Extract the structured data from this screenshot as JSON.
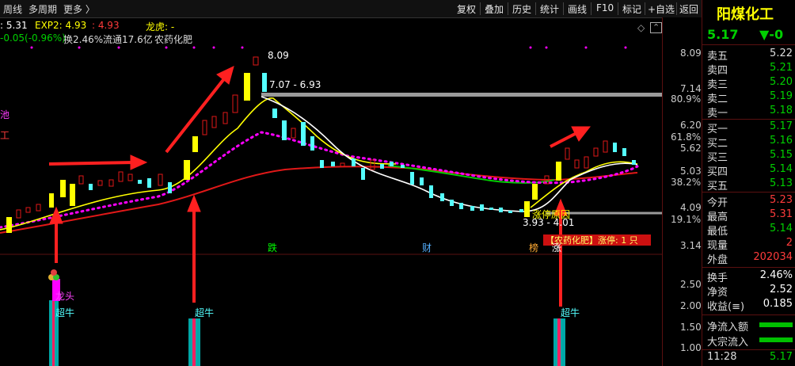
{
  "toolbar": {
    "left": [
      "周线",
      "多周期",
      "更多 〉"
    ],
    "buttons": [
      "复权",
      "叠加",
      "历史",
      "统计",
      "画线",
      "F10",
      "标记",
      "+自选",
      "返回"
    ]
  },
  "info": {
    "ma1": ": 5.31",
    "exp2_label": "EXP2: 4.93",
    "exp3_label": ": 4.93",
    "dragon_label": "龙虎: -",
    "change": "-0.05(-0.96%)",
    "turnover": "换2.46%",
    "float": "流通17.6亿",
    "industry": "农药化肥"
  },
  "side_text": [
    "池",
    "工"
  ],
  "price_axis": {
    "labels": [
      "8.09",
      "7.14",
      "80.9%",
      "6.20",
      "61.8%",
      "5.62",
      "5.03",
      "38.2%",
      "4.09",
      "19.1%",
      "3.14"
    ],
    "lower": [
      "2.50",
      "2.00",
      "1.50",
      "1.00"
    ]
  },
  "chart_annotations": {
    "high": "8.09",
    "range1": "7.07 - 6.93",
    "range2": "3.93 - 4.01",
    "reason": "涨停原因",
    "limit_up": "【农药化肥】涨停: 1 只",
    "markers": [
      "跌",
      "财",
      "榜",
      "涨"
    ]
  },
  "indicator": {
    "labels": [
      "龙头",
      "超牛",
      "超牛",
      "超牛"
    ]
  },
  "quote": {
    "name": "阳煤化工",
    "price": "5.17",
    "change": "▼-0",
    "asks": [
      {
        "label": "卖五",
        "value": "5.22"
      },
      {
        "label": "卖四",
        "value": "5.21"
      },
      {
        "label": "卖三",
        "value": "5.20"
      },
      {
        "label": "卖二",
        "value": "5.19"
      },
      {
        "label": "卖一",
        "value": "5.18"
      }
    ],
    "bids": [
      {
        "label": "买一",
        "value": "5.17"
      },
      {
        "label": "买二",
        "value": "5.16"
      },
      {
        "label": "买三",
        "value": "5.15"
      },
      {
        "label": "买四",
        "value": "5.14"
      },
      {
        "label": "买五",
        "value": "5.13"
      }
    ],
    "stats": [
      {
        "label": "今开",
        "value": "5.23"
      },
      {
        "label": "最高",
        "value": "5.31"
      },
      {
        "label": "最低",
        "value": "5.14"
      },
      {
        "label": "现量",
        "value": "2"
      },
      {
        "label": "外盘",
        "value": "202034"
      },
      {
        "label": "换手",
        "value": "2.46%"
      },
      {
        "label": "净资",
        "value": "2.52"
      },
      {
        "label": "收益(≡)",
        "value": "0.185"
      }
    ],
    "flows": [
      "净流入额",
      "大宗流入"
    ],
    "time": "11:28",
    "last": "5.17"
  },
  "colors": {
    "up": "#ff3b3b",
    "down": "#54ffff",
    "yellow": "#ffff00",
    "magenta": "#ff00ff",
    "green": "#00cc00"
  }
}
